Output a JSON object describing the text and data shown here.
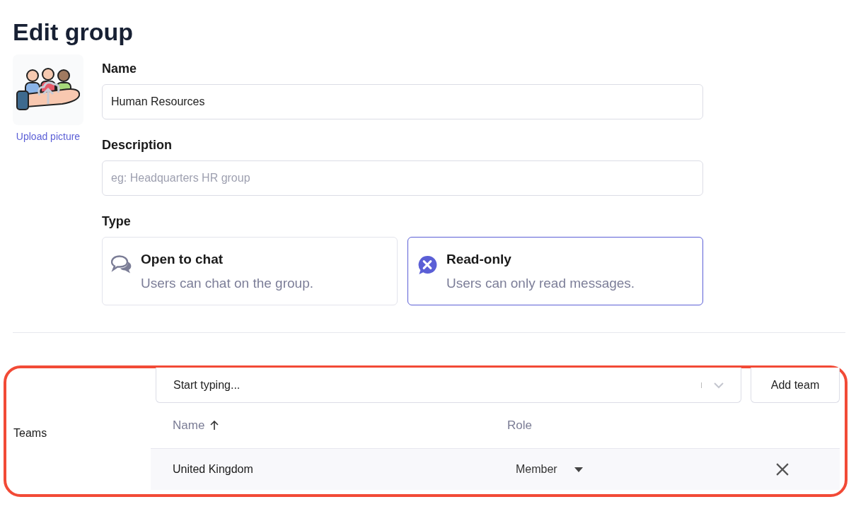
{
  "title": "Edit group",
  "picture": {
    "link": "Upload picture"
  },
  "name_field": {
    "label": "Name",
    "value": "Human Resources"
  },
  "description_field": {
    "label": "Description",
    "placeholder": "eg: Headquarters HR group"
  },
  "type": {
    "label": "Type",
    "options": [
      {
        "kind": "chat",
        "title": "Open to chat",
        "description": "Users can chat on the group.",
        "selected": false
      },
      {
        "kind": "readonly",
        "title": "Read-only",
        "description": "Users can only read messages.",
        "selected": true
      }
    ]
  },
  "teams": {
    "label": "Teams",
    "search": {
      "placeholder": "Start typing..."
    },
    "add_button": "Add team",
    "columns": [
      {
        "label": "Name",
        "sorted": true
      },
      {
        "label": "Role",
        "sorted": false
      }
    ],
    "rows": [
      {
        "name": "United Kingdom",
        "role": "Member"
      }
    ]
  }
}
